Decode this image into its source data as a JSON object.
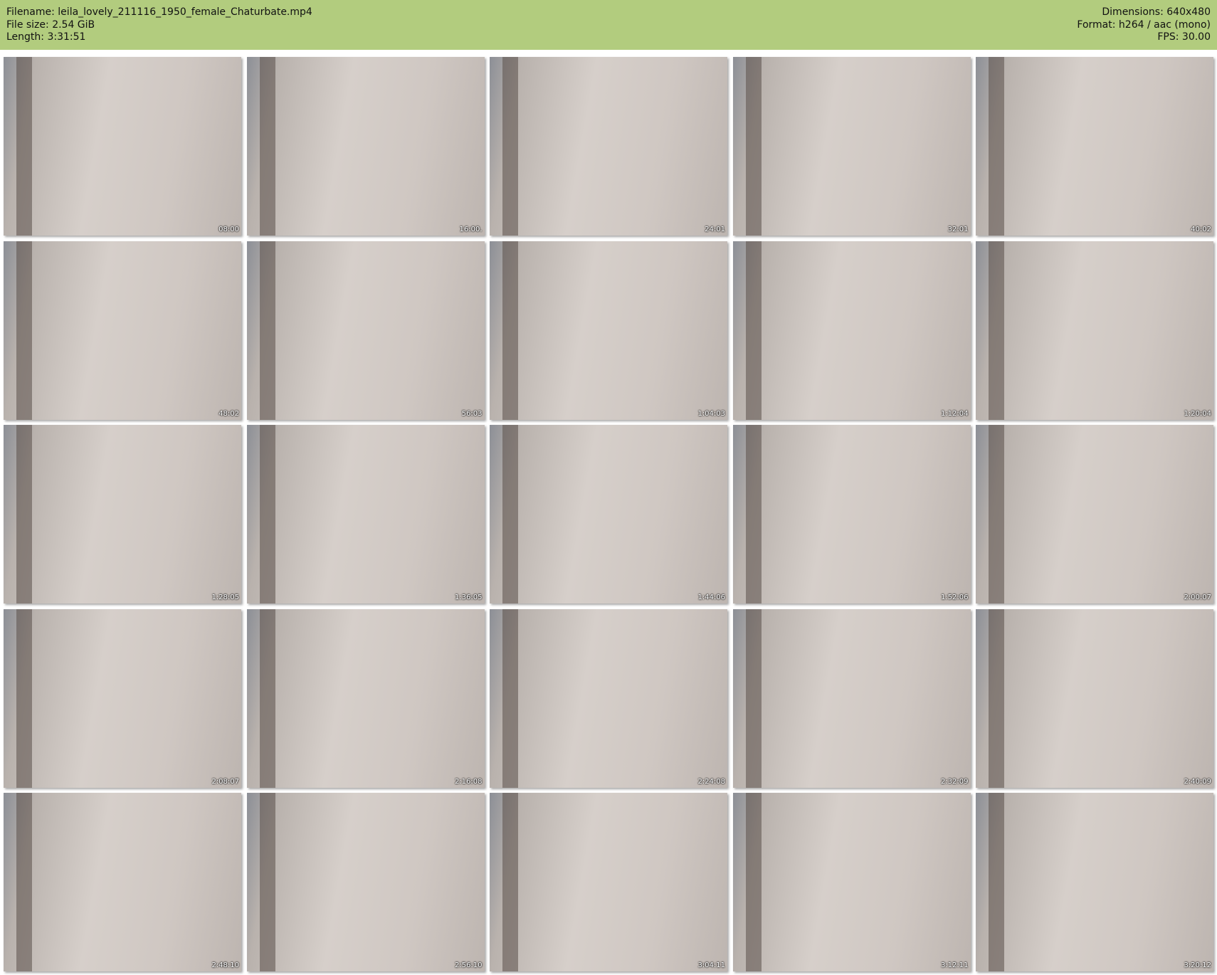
{
  "header": {
    "filename": "Filename: leila_lovely_211116_1950_female_Chaturbate.mp4",
    "filesize": "File size: 2.54 GiB",
    "length": "Length: 3:31:51",
    "dimensions": "Dimensions: 640x480",
    "format": "Format: h264 / aac (mono)",
    "fps": "FPS: 30.00"
  },
  "thumbnails": [
    "08:00",
    "16:00.",
    "24:01",
    "32:01",
    "40:02",
    "48:02",
    "56:03",
    "1:04:03",
    "1:12:04",
    "1:20:04",
    "1:28:05",
    "1:36:05",
    "1:44:06",
    "1:52:06",
    "2:00:07",
    "2:08:07",
    "2:16:08",
    "2:24:08",
    "2:32:09",
    "2:40:09",
    "2:48:10",
    "2:56:10",
    "3:04:11",
    "3:12:11",
    "3:20:12"
  ],
  "colors": {
    "header_bg": "#b2cc7e"
  }
}
